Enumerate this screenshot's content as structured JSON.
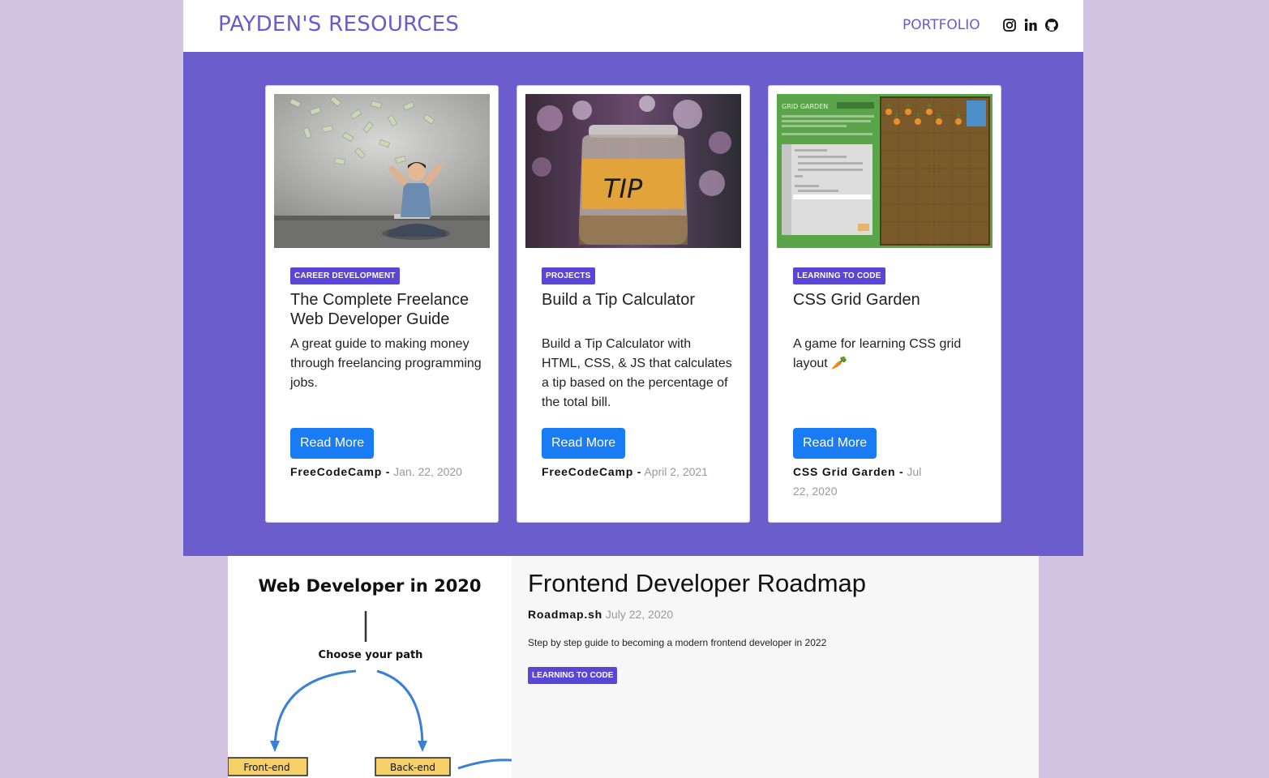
{
  "nav": {
    "brand": "PAYDEN'S RESOURCES",
    "portfolio": "PORTFOLIO",
    "social": [
      "instagram-icon",
      "linkedin-icon",
      "github-icon"
    ]
  },
  "cards": [
    {
      "category": "CAREER DEVELOPMENT",
      "title": "The Complete Freelance Web Developer Guide",
      "description": "A great guide to making money through freelancing programming jobs.",
      "button": "Read More",
      "source": "FreeCodeCamp -",
      "date": "Jan. 22, 2020"
    },
    {
      "category": "PROJECTS",
      "title": "Build a Tip Calculator",
      "description": "Build a Tip Calculator with HTML, CSS, & JS that calculates a tip based on the percentage of the total bill.",
      "button": "Read More",
      "source": "FreeCodeCamp -",
      "date": "April 2, 2021",
      "image_text": "TIP"
    },
    {
      "category": "LEARNING TO CODE",
      "title": "CSS Grid Garden",
      "description": "A game for learning CSS grid layout 🥕",
      "button": "Read More",
      "source": "CSS Grid Garden -",
      "date": "Jul 22, 2020",
      "image_text": "GRID GARDEN"
    }
  ],
  "feature": {
    "image": {
      "heading": "Web Developer in 2020",
      "path_label": "Choose your path",
      "left": "Front-end",
      "right": "Back-end"
    },
    "title": "Frontend Developer Roadmap",
    "source": "Roadmap.sh",
    "date": "July 22, 2020",
    "description": "Step by step guide to becoming a modern frontend developer in 2022",
    "category": "LEARNING TO CODE"
  },
  "colors": {
    "page_bg": "#d3c3e2",
    "hero_bg": "#6b5ecc",
    "brand": "#6b5bd0",
    "badge": "#5a46d6",
    "button": "#1a7cf5"
  }
}
